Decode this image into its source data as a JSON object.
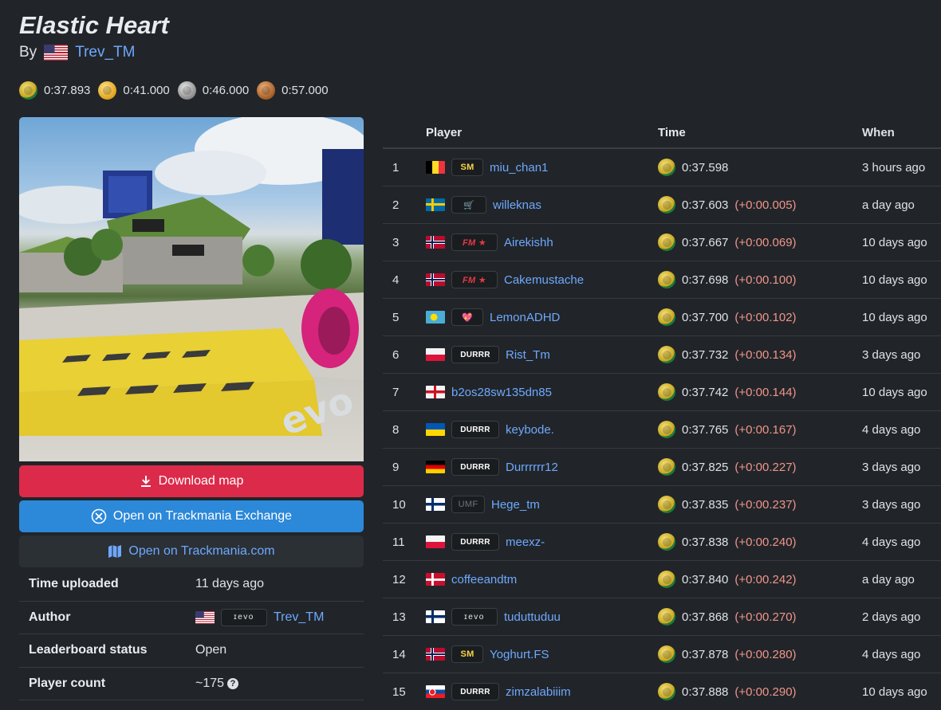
{
  "map": {
    "title": "Elastic Heart",
    "by_label": "By",
    "author": "Trev_TM",
    "author_flag": "flag-us"
  },
  "medals": [
    {
      "type": "author",
      "icon": "author-medal-icon",
      "time": "0:37.893"
    },
    {
      "type": "gold",
      "icon": "gold-medal-icon",
      "time": "0:41.000"
    },
    {
      "type": "silver",
      "icon": "silver-medal-icon",
      "time": "0:46.000"
    },
    {
      "type": "bronze",
      "icon": "bronze-medal-icon",
      "time": "0:57.000"
    }
  ],
  "buttons": {
    "download": "Download map",
    "tmx": "Open on Trackmania Exchange",
    "tmcom": "Open on Trackmania.com"
  },
  "info": {
    "time_uploaded_label": "Time uploaded",
    "time_uploaded": "11 days ago",
    "author_label": "Author",
    "author_tag": "ɪevo",
    "author": "Trev_TM",
    "status_label": "Leaderboard status",
    "status": "Open",
    "player_count_label": "Player count",
    "player_count": "~175"
  },
  "leaderboard": {
    "headers": {
      "player": "Player",
      "time": "Time",
      "when": "When"
    },
    "rows": [
      {
        "rank": "1",
        "flag": "flag-be",
        "tag": "SM",
        "tagClass": "tag-sm",
        "name": "miu_chan1",
        "time": "0:37.598",
        "delta": "",
        "when": "3 hours ago"
      },
      {
        "rank": "2",
        "flag": "flag-se",
        "tag": "🛒",
        "tagClass": "tag-kart",
        "name": "willeknas",
        "time": "0:37.603",
        "delta": "(+0:00.005)",
        "when": "a day ago"
      },
      {
        "rank": "3",
        "flag": "flag-no",
        "tag": "FM ★",
        "tagClass": "tag-fm",
        "name": "Airekishh",
        "time": "0:37.667",
        "delta": "(+0:00.069)",
        "when": "10 days ago"
      },
      {
        "rank": "4",
        "flag": "flag-no",
        "tag": "FM ★",
        "tagClass": "tag-fm",
        "name": "Cakemustache",
        "time": "0:37.698",
        "delta": "(+0:00.100)",
        "when": "10 days ago"
      },
      {
        "rank": "5",
        "flag": "flag-pw",
        "tag": "💖",
        "tagClass": "tag-heart",
        "name": "LemonADHD",
        "time": "0:37.700",
        "delta": "(+0:00.102)",
        "when": "10 days ago"
      },
      {
        "rank": "6",
        "flag": "flag-pl",
        "tag": "DURRR",
        "tagClass": "tag-durrr",
        "name": "Rist_Tm",
        "time": "0:37.732",
        "delta": "(+0:00.134)",
        "when": "3 days ago"
      },
      {
        "rank": "7",
        "flag": "flag-en",
        "tag": "",
        "tagClass": "",
        "name": "b2os28sw135dn85",
        "time": "0:37.742",
        "delta": "(+0:00.144)",
        "when": "10 days ago"
      },
      {
        "rank": "8",
        "flag": "flag-ua",
        "tag": "DURRR",
        "tagClass": "tag-durrr",
        "name": "keybode.",
        "time": "0:37.765",
        "delta": "(+0:00.167)",
        "when": "4 days ago"
      },
      {
        "rank": "9",
        "flag": "flag-de",
        "tag": "DURRR",
        "tagClass": "tag-durrr",
        "name": "Durrrrrr12",
        "time": "0:37.825",
        "delta": "(+0:00.227)",
        "when": "3 days ago"
      },
      {
        "rank": "10",
        "flag": "flag-fi",
        "tag": "UMF",
        "tagClass": "tag-umf",
        "name": "Hege_tm",
        "time": "0:37.835",
        "delta": "(+0:00.237)",
        "when": "3 days ago"
      },
      {
        "rank": "11",
        "flag": "flag-pl",
        "tag": "DURRR",
        "tagClass": "tag-durrr",
        "name": "meexz-",
        "time": "0:37.838",
        "delta": "(+0:00.240)",
        "when": "4 days ago"
      },
      {
        "rank": "12",
        "flag": "flag-dk",
        "tag": "",
        "tagClass": "",
        "name": "coffeeandtm",
        "time": "0:37.840",
        "delta": "(+0:00.242)",
        "when": "a day ago"
      },
      {
        "rank": "13",
        "flag": "flag-fi",
        "tag": "ɪevo",
        "tagClass": "tag-evo",
        "name": "tuduttuduu",
        "time": "0:37.868",
        "delta": "(+0:00.270)",
        "when": "2 days ago"
      },
      {
        "rank": "14",
        "flag": "flag-no",
        "tag": "SM",
        "tagClass": "tag-sm",
        "name": "Yoghurt.FS",
        "time": "0:37.878",
        "delta": "(+0:00.280)",
        "when": "4 days ago"
      },
      {
        "rank": "15",
        "flag": "flag-sk",
        "tag": "DURRR",
        "tagClass": "tag-durrr",
        "name": "zimzalabiiim",
        "time": "0:37.888",
        "delta": "(+0:00.290)",
        "when": "10 days ago"
      }
    ]
  },
  "colors": {
    "background": "#212529",
    "link": "#6ea8fe",
    "download_button": "#dc2a4a",
    "tmx_button": "#2c88d9",
    "delta": "#f1948a"
  }
}
